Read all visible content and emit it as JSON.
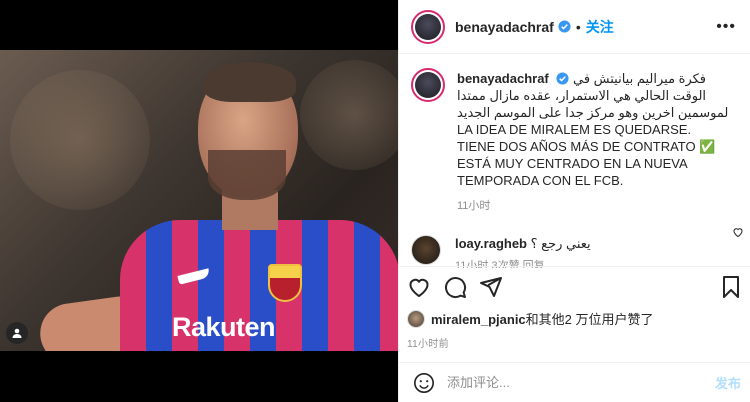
{
  "header": {
    "username": "benayadachraf",
    "separator": "•",
    "follow_label": "关注",
    "more_icon": "more-horizontal-icon"
  },
  "caption": {
    "username": "benayadachraf",
    "text": "فكرة ميراليم بيانيتش في الوقت الحالي هي الاستمرار، عقده مازال ممتدا لموسمين اخرين وهو مركز جدا على الموسم الجديد LA IDEA DE MIRALEM ES QUEDARSE. TIENE DOS AÑOS MÁS DE CONTRATO ✅ ESTÁ MUY CENTRADO EN LA NUEVA TEMPORADA CON EL FCB.",
    "time": "11小时"
  },
  "comment": {
    "username": "loay.ragheb",
    "text": "يعني رجع ؟",
    "meta": "11小时   3次赞   回复"
  },
  "likes": {
    "user": "miralem_pjanic",
    "rest": "和其他2 万位用户赞了"
  },
  "post_time": "11小时前",
  "add_comment": {
    "placeholder": "添加评论...",
    "post_label": "发布"
  },
  "photo": {
    "sponsor": "Rakuten"
  },
  "colors": {
    "accent": "#0095f6",
    "ring": "#d62a72",
    "muted": "#8e8e8e"
  }
}
